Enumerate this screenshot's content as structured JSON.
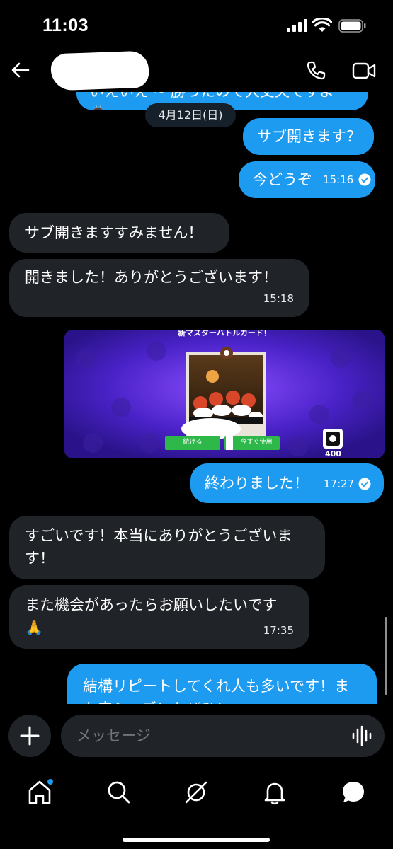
{
  "status_bar": {
    "time": "11:03"
  },
  "header": {
    "back_label": ""
  },
  "date_separator": "4月12日(日)",
  "messages": {
    "partial_top": "いえいえ ~ 勝ったので大丈夫ですよ",
    "m1": {
      "text": "サブ開きます？"
    },
    "m2": {
      "text": "今どうぞ",
      "time": "15:16"
    },
    "m3": {
      "text": "サブ開きますすみません！"
    },
    "m4": {
      "text": "開きました！ありがとうございます！",
      "time": "15:18"
    },
    "image": {
      "title": "新マスターバトルカード！",
      "btn_left": "続ける",
      "btn_right": "今すぐ使用",
      "count": "400"
    },
    "m5": {
      "text": "終わりました！",
      "time": "17:27"
    },
    "m6": {
      "line1": "すごいです！本当にありがとうございま",
      "line2": "す！"
    },
    "m7": {
      "line1": "また機会があったらお願いしたいです",
      "emoji": "🙏",
      "time": "17:35"
    },
    "m8": {
      "line1": "結構リピートしてくれ人も多いです！ま",
      "line2": "た来シーズンもぜひ！"
    }
  },
  "composer": {
    "placeholder": "メッセージ"
  },
  "tabs": [
    "home",
    "search",
    "grok",
    "notifications",
    "messages"
  ],
  "colors": {
    "outgoing": "#1d9bf0",
    "incoming": "#202327",
    "background": "#000000"
  }
}
